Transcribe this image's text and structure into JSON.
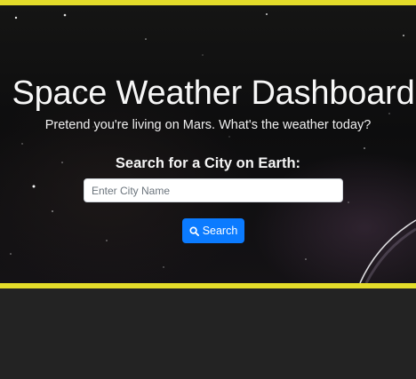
{
  "hero": {
    "title": "Space Weather Dashboard",
    "subtitle": "Pretend you're living on Mars. What's the weather today?",
    "search_label": "Search for a City on Earth:",
    "search_placeholder": "Enter City Name",
    "search_value": "",
    "search_button_label": "Search",
    "search_button_icon": "search-icon"
  },
  "colors": {
    "accent_border": "#e3dc2a",
    "button_primary": "#0b7bff",
    "page_background": "#232323"
  }
}
